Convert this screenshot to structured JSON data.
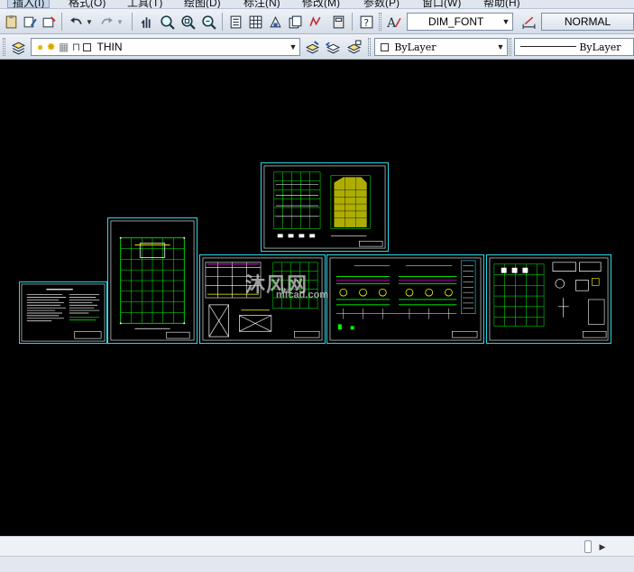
{
  "menu": {
    "items": [
      {
        "label": "插入(I)",
        "active": true
      },
      {
        "label": "格式(O)"
      },
      {
        "label": "工具(T)"
      },
      {
        "label": "绘图(D)"
      },
      {
        "label": "标注(N)"
      },
      {
        "label": "修改(M)"
      },
      {
        "label": "参数(P)"
      },
      {
        "label": "窗口(W)"
      },
      {
        "label": "帮助(H)"
      }
    ]
  },
  "toolbar1": {
    "text_style": "DIM_FONT",
    "dim_style": "NORMAL"
  },
  "toolbar2": {
    "layer": "THIN",
    "color": "ByLayer",
    "linetype": "ByLayer"
  },
  "watermark": {
    "main": "沐风网",
    "sub": "mfcad.com"
  },
  "colors": {
    "background": "#000000",
    "sheet_border": "#2fd6e8",
    "drawing_line": "#ffffff",
    "accent_green": "#00ff00",
    "accent_yellow": "#ffff00",
    "accent_magenta": "#ff00ff"
  }
}
